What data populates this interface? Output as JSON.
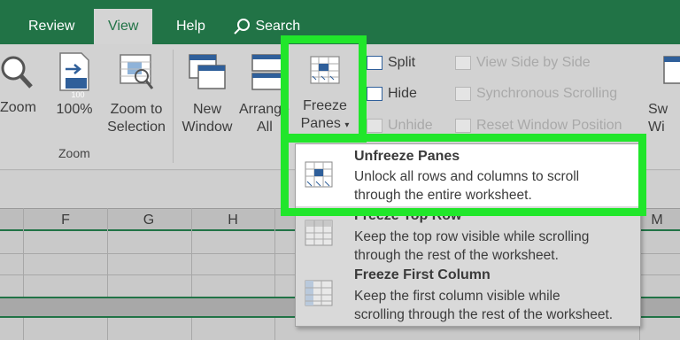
{
  "tabs": {
    "review": "Review",
    "view": "View",
    "help": "Help",
    "search": "Search"
  },
  "ribbon": {
    "zoom_btn": "Zoom",
    "hundred_btn": "100%",
    "hundred_badge": "100",
    "zoom_sel_1": "Zoom to",
    "zoom_sel_2": "Selection",
    "zoom_group": "Zoom",
    "new_window_1": "New",
    "new_window_2": "Window",
    "arrange_1": "Arrange",
    "arrange_2": "All",
    "freeze_1": "Freeze",
    "freeze_2": "Panes",
    "split": "Split",
    "hide": "Hide",
    "unhide": "Unhide",
    "view_side": "View Side by Side",
    "sync_scroll": "Synchronous Scrolling",
    "reset_pos": "Reset Window Position",
    "switch_1": "Sw",
    "switch_2": "Wi"
  },
  "columns": [
    "F",
    "G",
    "H",
    "M"
  ],
  "menu": {
    "unfreeze_title": "Unfreeze Panes",
    "unfreeze_desc_1": "Unlock all rows and columns to scroll",
    "unfreeze_desc_2": "through the entire worksheet.",
    "top_row_title": "Freeze Top Row",
    "top_row_desc_1": "Keep the top row visible while scrolling",
    "top_row_desc_2": "through the rest of the worksheet.",
    "first_col_title": "Freeze First Column",
    "first_col_desc_1": "Keep the first column visible while",
    "first_col_desc_2": "scrolling through the rest of the worksheet."
  },
  "colors": {
    "excel_green": "#217346",
    "highlight_green": "#21e62b",
    "icon_blue": "#2f5f9a"
  }
}
